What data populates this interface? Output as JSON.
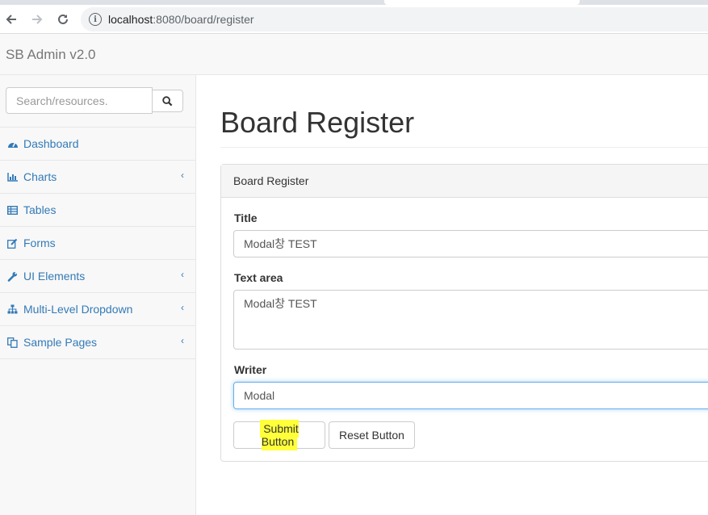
{
  "browser": {
    "url_host": "localhost",
    "url_path": ":8080/board/register",
    "info_icon": "i"
  },
  "app": {
    "brand": "SB Admin v2.0"
  },
  "sidebar": {
    "search_placeholder": "Search/resources.",
    "items": [
      {
        "label": "Dashboard",
        "icon": "dashboard-icon",
        "has_submenu": false
      },
      {
        "label": "Charts",
        "icon": "bar-chart-icon",
        "has_submenu": true
      },
      {
        "label": "Tables",
        "icon": "table-icon",
        "has_submenu": false
      },
      {
        "label": "Forms",
        "icon": "edit-icon",
        "has_submenu": false
      },
      {
        "label": "UI Elements",
        "icon": "wrench-icon",
        "has_submenu": true
      },
      {
        "label": "Multi-Level Dropdown",
        "icon": "sitemap-icon",
        "has_submenu": true
      },
      {
        "label": "Sample Pages",
        "icon": "files-icon",
        "has_submenu": true
      }
    ],
    "chevron": "‹"
  },
  "main": {
    "page_title": "Board Register",
    "panel_heading": "Board Register",
    "title_label": "Title",
    "title_value": "Modal창 TEST",
    "content_label": "Text area",
    "content_value": "Modal창 TEST",
    "writer_label": "Writer",
    "writer_value": "Modal",
    "submit_label": "Submit Button",
    "reset_label": "Reset Button"
  },
  "colors": {
    "link": "#337ab7",
    "highlight": "#ffff3a",
    "focus_border": "#66afe9"
  }
}
